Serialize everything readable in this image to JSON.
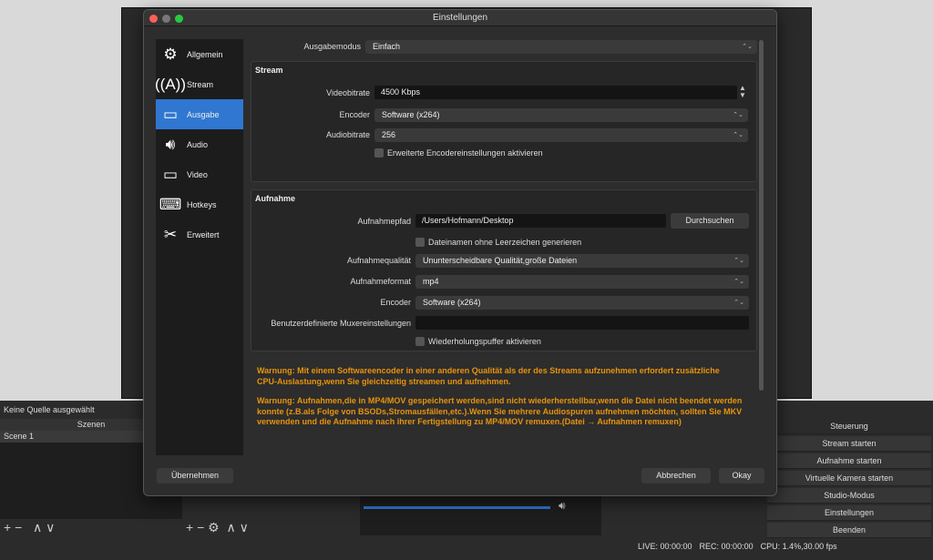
{
  "dialog": {
    "title": "Einstellungen",
    "sidebar": [
      {
        "label": "Allgemein",
        "icon": "gear-icon"
      },
      {
        "label": "Stream",
        "icon": "antenna-icon"
      },
      {
        "label": "Ausgabe",
        "icon": "monitor-output-icon"
      },
      {
        "label": "Audio",
        "icon": "speaker-icon"
      },
      {
        "label": "Video",
        "icon": "monitor-icon"
      },
      {
        "label": "Hotkeys",
        "icon": "keyboard-icon"
      },
      {
        "label": "Erweitert",
        "icon": "tools-icon"
      }
    ],
    "active_section": "Ausgabe",
    "output_mode_label": "Ausgabemodus",
    "output_mode": "Einfach",
    "stream": {
      "title": "Stream",
      "video_bitrate_label": "Videobitrate",
      "video_bitrate": "4500 Kbps",
      "encoder_label": "Encoder",
      "encoder": "Software (x264)",
      "audio_bitrate_label": "Audiobitrate",
      "audio_bitrate": "256",
      "advanced_label": "Erweiterte Encodereinstellungen aktivieren"
    },
    "recording": {
      "title": "Aufnahme",
      "path_label": "Aufnahmepfad",
      "path": "/Users/Hofmann/Desktop",
      "browse": "Durchsuchen",
      "no_spaces_label": "Dateinamen ohne Leerzeichen generieren",
      "quality_label": "Aufnahmequalität",
      "quality": "Ununterscheidbare Qualität,große Dateien",
      "format_label": "Aufnahmeformat",
      "format": "mp4",
      "encoder_label": "Encoder",
      "encoder": "Software (x264)",
      "muxer_label": "Benutzerdefinierte Muxereinstellungen",
      "muxer": "",
      "replay_label": "Wiederholungspuffer aktivieren"
    },
    "warning1": "Warnung: Mit einem Softwareencoder in einer anderen Qualität als der des Streams aufzunehmen erfordert zusätzliche CPU-Auslastung,wenn Sie gleichzeitig streamen und aufnehmen.",
    "warning2": "Warnung: Aufnahmen,die in MP4/MOV gespeichert werden,sind nicht wiederherstellbar,wenn die Datei nicht beendet werden konnte (z.B.als Folge von BSODs,Stromausfällen,etc.).Wenn Sie mehrere Audiospuren aufnehmen möchten, sollten Sie MKV verwenden und die Aufnahme nach ihrer Fertigstellung zu MP4/MOV remuxen.(Datei → Aufnahmen remuxen)",
    "apply": "Übernehmen",
    "cancel": "Abbrechen",
    "ok": "Okay"
  },
  "main": {
    "no_source": "Keine Quelle ausgewählt",
    "scenes_header": "Szenen",
    "scenes": [
      "Scene 1"
    ],
    "controls_header": "Steuerung",
    "controls": [
      "Stream starten",
      "Aufnahme starten",
      "Virtuelle Kamera starten",
      "Studio-Modus",
      "Einstellungen",
      "Beenden"
    ],
    "status": {
      "live": "LIVE: 00:00:00",
      "rec": "REC: 00:00:00",
      "cpu": "CPU: 1.4%,30.00 fps"
    }
  },
  "colors": {
    "accent": "#2f77d0",
    "warning": "#e8930c"
  }
}
